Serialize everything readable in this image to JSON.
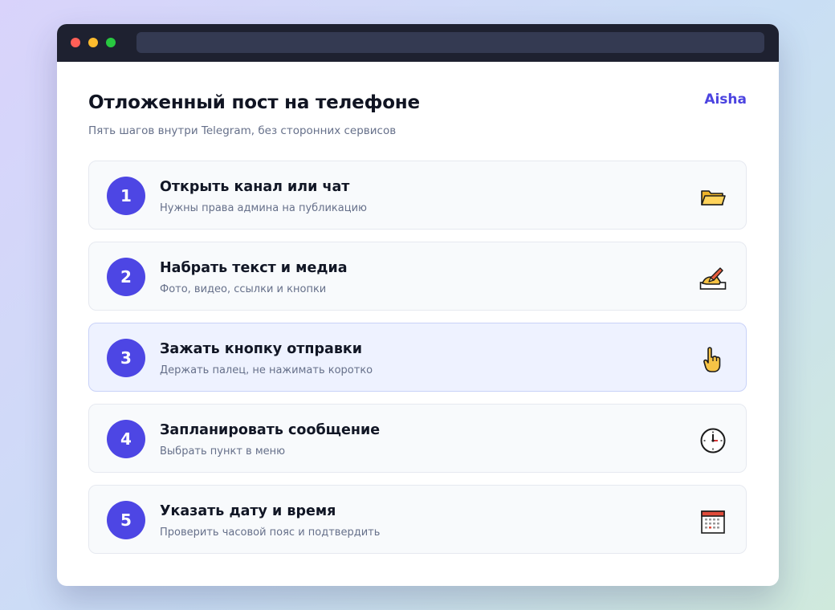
{
  "header": {
    "title": "Отложенный пост на телефоне",
    "subtitle": "Пять шагов внутри Telegram, без сторонних сервисов",
    "user": "Aisha"
  },
  "colors": {
    "accent": "#4d46e4",
    "active_step_bg": "#eef2ff"
  },
  "steps": [
    {
      "number": "1",
      "title": "Открыть канал или чат",
      "description": "Нужны права админа на публикацию",
      "icon": "folder-icon"
    },
    {
      "number": "2",
      "title": "Набрать текст и медиа",
      "description": "Фото, видео, ссылки и кнопки",
      "icon": "writing-hand-icon"
    },
    {
      "number": "3",
      "title": "Зажать кнопку отправки",
      "description": "Держать палец, не нажимать коротко",
      "icon": "pointing-hand-icon",
      "active": true
    },
    {
      "number": "4",
      "title": "Запланировать сообщение",
      "description": "Выбрать пункт в меню",
      "icon": "clock-icon"
    },
    {
      "number": "5",
      "title": "Указать дату и время",
      "description": "Проверить часовой пояс и подтвердить",
      "icon": "calendar-icon"
    }
  ]
}
